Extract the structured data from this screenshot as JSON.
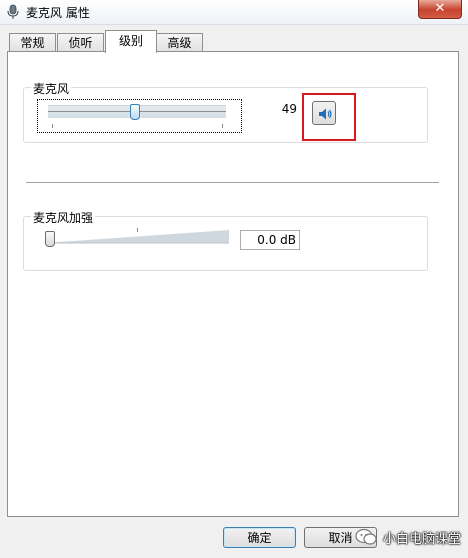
{
  "window": {
    "title": "麦克风 属性",
    "close_glyph": "✕",
    "close_color": "#c7432d"
  },
  "tabs": [
    {
      "label": "常规",
      "active": false
    },
    {
      "label": "侦听",
      "active": false
    },
    {
      "label": "级别",
      "active": true
    },
    {
      "label": "高级",
      "active": false
    }
  ],
  "microphone": {
    "label": "麦克风",
    "level": 49,
    "level_fraction": 0.49,
    "level_text": "49",
    "mute_icon": "speaker-icon"
  },
  "boost": {
    "label": "麦克风加强",
    "value_text": "0.0 dB",
    "level_fraction": 0.0
  },
  "footer": {
    "ok_label": "确定",
    "cancel_label": "取消",
    "watermark_text": "小白电脑课堂"
  },
  "highlight_color": "#d7191c"
}
